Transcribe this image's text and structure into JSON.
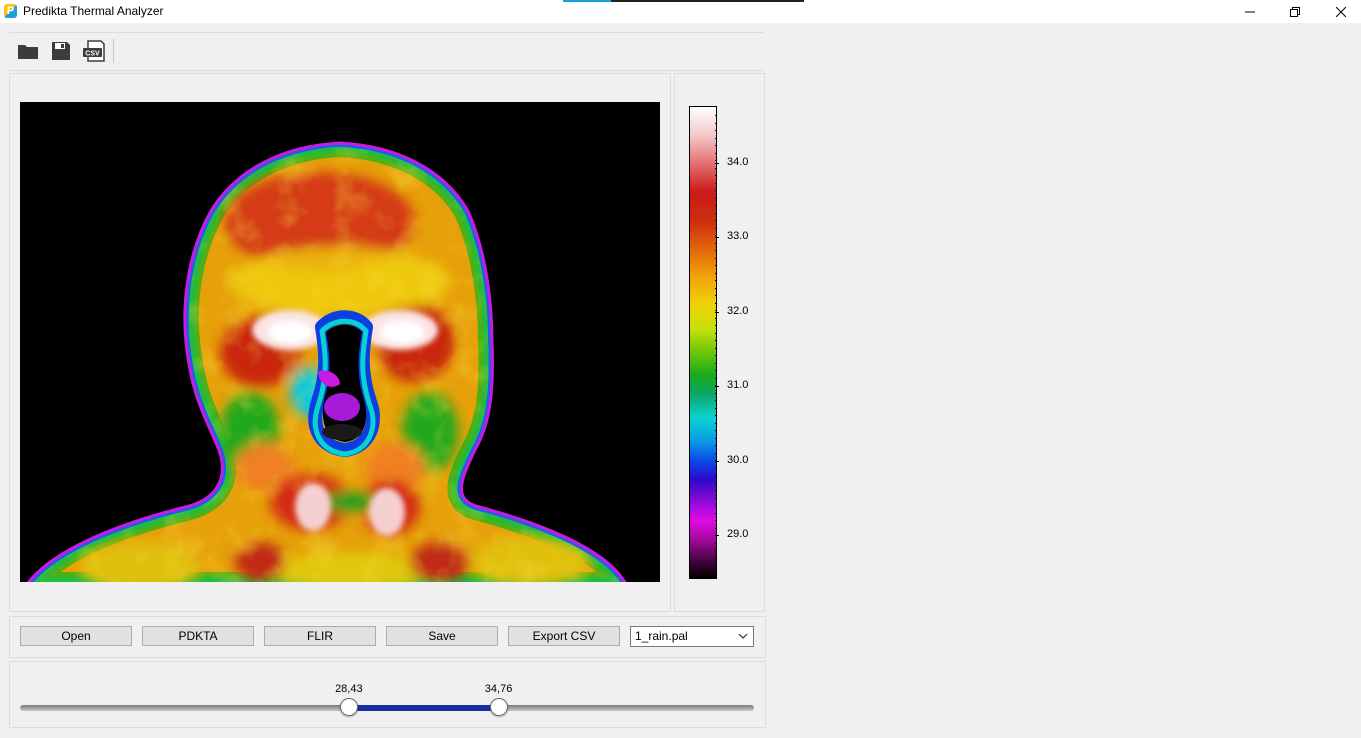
{
  "window": {
    "title": "Predikta Thermal Analyzer",
    "app_icon_letter": "P"
  },
  "toolbar": {
    "icons": [
      "folder-icon",
      "save-icon",
      "csv-icon"
    ],
    "csv_glyph": "CSV"
  },
  "colorbar": {
    "ticks": [
      "34.0",
      "33.0",
      "32.0",
      "31.0",
      "30.0",
      "29.0"
    ],
    "palette_top": "#ffffff",
    "palette_bottom": "#000000"
  },
  "buttons": {
    "open": "Open",
    "pdkta": "PDKTA",
    "flir": "FLIR",
    "save": "Save",
    "export_csv": "Export CSV"
  },
  "palette_select": {
    "value": "1_rain.pal"
  },
  "range_slider": {
    "low_label": "28,43",
    "high_label": "34,76",
    "low_fraction": 0.448,
    "high_fraction": 0.652,
    "range_color": "#1b2fa0"
  }
}
